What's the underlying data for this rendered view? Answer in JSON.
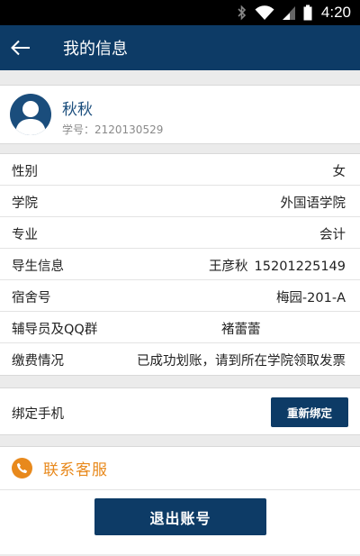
{
  "status_bar": {
    "time": "4:20",
    "icons": [
      "bluetooth-icon",
      "wifi-icon",
      "signal-icon",
      "battery-icon"
    ]
  },
  "app_bar": {
    "title": "我的信息",
    "back_icon": "arrow-left-icon"
  },
  "profile": {
    "name": "秋秋",
    "student_id": "学号：2120130529"
  },
  "info": {
    "gender": {
      "label": "性别",
      "value": "女"
    },
    "college": {
      "label": "学院",
      "value": "外国语学院"
    },
    "major": {
      "label": "专业",
      "value": "会计"
    },
    "advisor": {
      "label": "导生信息",
      "name": "王彦秋",
      "phone": "15201225149"
    },
    "dorm": {
      "label": "宿舍号",
      "value": "梅园-201-A"
    },
    "counselor": {
      "label": "辅导员及QQ群",
      "value": "褚蕾蕾"
    },
    "payment": {
      "label": "缴费情况",
      "value": "已成功划账，请到所在学院领取发票"
    }
  },
  "bind_phone": {
    "label": "绑定手机",
    "button": "重新绑定"
  },
  "contact": {
    "label": "联系客服"
  },
  "logout": {
    "label": "退出账号"
  },
  "colors": {
    "primary": "#0d3b66",
    "accent": "#e8891c",
    "background": "#ebebeb"
  }
}
